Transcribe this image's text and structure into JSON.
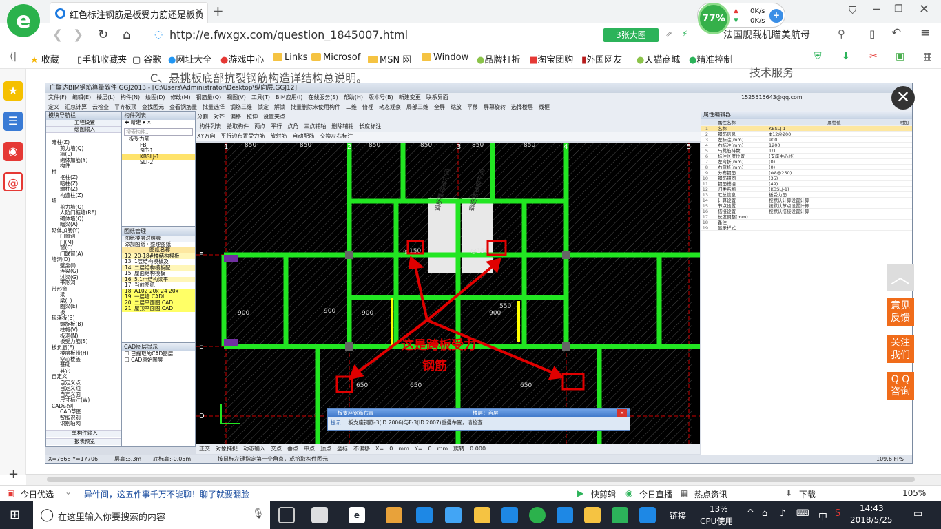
{
  "browser": {
    "tab_title": "红色标注钢筋是板受力筋还是板负",
    "url": "http://e.fwxgx.com/question_1845007.html",
    "big_pic_label": "3张大图",
    "speed_percent": "77%",
    "speed_up": "0K/s",
    "speed_down": "0K/s",
    "ad_text": "法国舰载机瞄美航母"
  },
  "bookmarks": [
    "收藏",
    "手机收藏夹",
    "谷歌",
    "网址大全",
    "游戏中心",
    "Links",
    "Microsof",
    "MSN 网",
    "Window",
    "品牌打折",
    "淘宝团购",
    "外国网友",
    "天猫商城",
    "精准控制"
  ],
  "app": {
    "title": "广联达BIM钢筋算量软件 GGJ2013 - [C:\\Users\\Administrator\\Desktop\\纵向层.GGJ12]",
    "menu": [
      "文件(F)",
      "编辑(E)",
      "楼层(L)",
      "构件(N)",
      "绘图(D)",
      "修改(M)",
      "钢筋量(Q)",
      "视图(V)",
      "工具(T)",
      "BIM应用(I)",
      "在线服务(S)",
      "帮助(H)",
      "版本号(B)",
      "新建变更",
      "联系界面"
    ],
    "user": "1525515643@qq.com",
    "toolbar2": [
      "定义",
      "汇总计算",
      "云检查",
      "平齐板顶",
      "查找图元",
      "查看钢筋量",
      "批量选择",
      "钢筋三维",
      "锁定",
      "解锁",
      "批量删除未使用构件",
      "二维",
      "俯视",
      "动态观察",
      "局部三维",
      "全屏",
      "缩放",
      "平移",
      "屏幕旋转",
      "选择楼层",
      "线框"
    ],
    "toolbar3": [
      "删除",
      "复制",
      "镜像",
      "移动",
      "旋转",
      "延伸",
      "修剪",
      "打断",
      "合并",
      "分割",
      "对齐",
      "偏移",
      "拉伸",
      "设置夹点"
    ],
    "toolbar4": [
      "首层",
      "板",
      "板受力筋",
      "KBSLJ-1",
      "分层板1",
      "属性",
      "编辑钢筋",
      "构件列表",
      "拾取构件",
      "两点",
      "平行",
      "点角",
      "三点辅轴",
      "删除辅轴",
      "长度标注"
    ],
    "toolbar5": [
      "选择",
      "直线",
      "三点画弧",
      "单板",
      "多板",
      "自定义",
      "水平",
      "垂直",
      "XY方向",
      "平行边布置受力筋",
      "放射筋",
      "自动配筋",
      "交换左右标注"
    ],
    "nav_panel_title": "模块导航栏",
    "nav_sections": [
      "工程设置",
      "绘图输入"
    ],
    "nav_tree": [
      "暗柱(Z)",
      "剪力墙(Q)",
      "墙(L)",
      "砌体加筋(Y)",
      "构件",
      "柱",
      "框柱(Z)",
      "暗柱(Z)",
      "端柱(Z)",
      "构造柱(Z)",
      "墙",
      "剪力墙(Q)",
      "人防门框墙(RF)",
      "砌体墙(Q)",
      "暗梁(A)",
      "砌体加筋(Y)",
      "门窗洞",
      "门(M)",
      "窗(C)",
      "门联窗(A)",
      "墙洞(D)",
      "壁龛(I)",
      "连梁(G)",
      "过梁(G)",
      "带形洞",
      "带形窗",
      "梁",
      "梁(L)",
      "圈梁(E)",
      "板",
      "现浇板(B)",
      "螺旋板(B)",
      "柱帽(V)",
      "板洞(N)",
      "板受力筋(S)",
      "板负筋(F)",
      "楼层板带(H)",
      "空心楼盖",
      "基础",
      "其它",
      "自定义",
      "自定义点",
      "自定义线",
      "自定义面",
      "尺寸标注(W)",
      "CAD识别",
      "CAD草图",
      "智能识别",
      "识别轴网"
    ],
    "nav_bottom": [
      "单构件输入",
      "报表预览"
    ],
    "comp_list_title": "构件列表",
    "comp_new": "新建",
    "comp_search_placeholder": "搜索构件...",
    "comp_tree": [
      "板受力筋",
      "FBJ",
      "SLT-1",
      "KBSLJ-1",
      "SLT-2"
    ],
    "drawing_panel_title": "图纸管理",
    "drawing_tabs": [
      "图纸楼层对照表"
    ],
    "drawing_btns": [
      "添加图纸",
      "整理图纸"
    ],
    "drawing_header": "图纸名称",
    "drawing_rows": [
      [
        "12",
        "20-18#楼结构模板"
      ],
      [
        "13",
        "1层结构模板及"
      ],
      [
        "14",
        "二层结构模板配"
      ],
      [
        "15",
        "屋面结构模板"
      ],
      [
        "16",
        "5.1m结构梁平"
      ],
      [
        "17",
        "当前图纸"
      ],
      [
        "18",
        "A102 20x 24 20x"
      ],
      [
        "19",
        "一层墙.CADI"
      ],
      [
        "20",
        "二层平面图.CAD"
      ],
      [
        "21",
        "屋顶平面图.CAD"
      ]
    ],
    "cad_panel_title": "CAD图层显示",
    "cad_layers": [
      "已提取的CAD图层",
      "CAD原始图层"
    ],
    "props_title": "属性编辑器",
    "props_header": [
      "属性名称",
      "属性值",
      "附加"
    ],
    "props": [
      [
        "1",
        "名称",
        "KBSLJ-1"
      ],
      [
        "2",
        "钢筋信息",
        "Φ12@200"
      ],
      [
        "3",
        "左标注(mm)",
        "900"
      ],
      [
        "4",
        "右标注(mm)",
        "1200"
      ],
      [
        "5",
        "马凳筋排数",
        "1/1"
      ],
      [
        "6",
        "标注长度位置",
        "(支座中心线)"
      ],
      [
        "7",
        "左弯折(mm)",
        "(0)"
      ],
      [
        "8",
        "右弯折(mm)",
        "(0)"
      ],
      [
        "9",
        "分布钢筋",
        "(Φ8@250)"
      ],
      [
        "10",
        "钢筋锚固",
        "(35)"
      ],
      [
        "11",
        "钢筋搭接",
        "(49)"
      ],
      [
        "12",
        "归类名称",
        "(KBSLJ-1)"
      ],
      [
        "13",
        "汇总信息",
        "板受力筋"
      ],
      [
        "14",
        "计算设置",
        "按默认计算设置计算"
      ],
      [
        "15",
        "节点设置",
        "按默认节点设置计算"
      ],
      [
        "16",
        "搭接设置",
        "按默认搭接设置计算"
      ],
      [
        "17",
        "长度调整(mm)",
        ""
      ],
      [
        "18",
        "备注",
        ""
      ],
      [
        "19",
        "显示样式",
        ""
      ]
    ],
    "annotation": "这是跨板受力\n钢筋",
    "dialog_title": "板支座钢筋布置",
    "dialog_text": "板支座钢筋-3(ID:2006)与F-3(ID:2007)重叠布置，请检查",
    "dialog_prefix": "提示",
    "dialog_mid": "楼层：首层",
    "axis_labels": [
      "1",
      "2",
      "3",
      "4",
      "5",
      "F",
      "E",
      "D"
    ],
    "dims": [
      "850",
      "850",
      "850",
      "850",
      "850",
      "850",
      "900",
      "900",
      "900",
      "900",
      "650",
      "650",
      "650",
      "550",
      "@150",
      "@150"
    ],
    "canvas_text": [
      "钢筋楼梯梯中间"
    ],
    "status_coord": "X=7668  Y=17706",
    "status_floor": "层高:3.3m",
    "status_elev": "底标高:-0.05m",
    "status_hint": "按鼠标左键指定第一个角点，或拾取构件图元",
    "status_fps": "109.6 FPS",
    "snap_bar": [
      "正交",
      "对象捕捉",
      "动态输入",
      "交点",
      "垂点",
      "中点",
      "顶点",
      "坐标",
      "不偏移",
      "X=",
      "0",
      "mm",
      "Y=",
      "0",
      "mm",
      "旋转",
      "0.000"
    ]
  },
  "right_panel": {
    "feedback": "意见\n反馈",
    "follow": "关注\n我们",
    "qq": "Q Q\n咨询",
    "page_label": "技术服务",
    "fake_title": "C、悬挑板底部抗裂钢筋构造详结构总说明。"
  },
  "status_bar": [
    "今日优选",
    "异件间，这五件事千万不能聊！聊了就要翻脸",
    "快剪辑",
    "今日直播",
    "热点资讯",
    "下载",
    "105%"
  ],
  "taskbar": {
    "search_placeholder": "在这里输入你要搜索的内容",
    "link_label": "链接",
    "cpu_percent": "13%",
    "cpu_label": "CPU使用",
    "ime": "中",
    "time": "14:43",
    "date": "2018/5/25"
  },
  "colors": {
    "accent_green": "#2bb24c",
    "beam_green": "#22e622",
    "annotation_red": "#e00000",
    "orange": "#f06c1a"
  }
}
